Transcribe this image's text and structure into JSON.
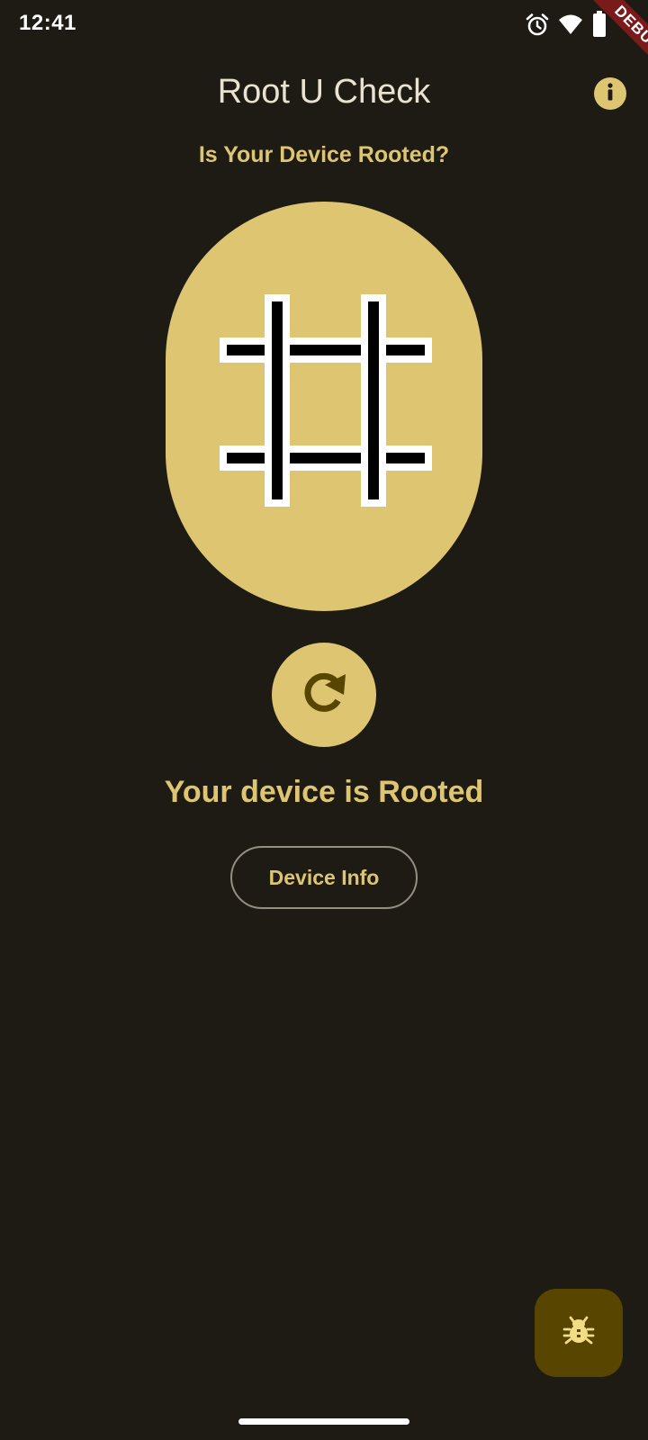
{
  "status_bar": {
    "time": "12:41",
    "icons": [
      "alarm-icon",
      "wifi-icon",
      "battery-icon"
    ]
  },
  "debug_banner": {
    "label": "DEBUG"
  },
  "app_bar": {
    "title": "Root U Check",
    "info_icon": "info-icon"
  },
  "main": {
    "question": "Is Your Device Rooted?",
    "hero_icon": "hash-icon",
    "refresh_icon": "refresh-icon",
    "result_text": "Your device is Rooted",
    "device_info_label": "Device Info"
  },
  "fab": {
    "icon": "bug-icon"
  },
  "colors": {
    "background": "#1e1b14",
    "accent": "#dec571",
    "title_text": "#eae2d0",
    "fab_background": "#574500",
    "debug_ribbon": "#7a1b1b"
  }
}
